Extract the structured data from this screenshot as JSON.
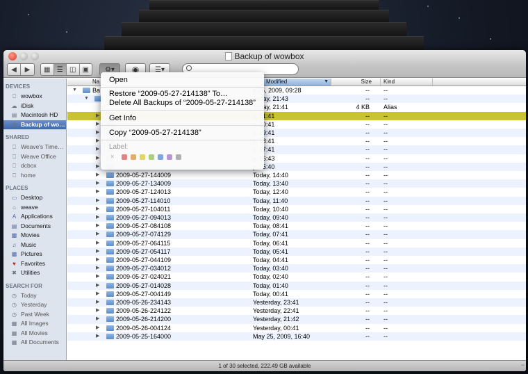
{
  "window": {
    "title": "Backup of wowbox",
    "status": "1 of 30 selected, 222.49 GB available"
  },
  "sidebar": {
    "sections": [
      {
        "title": "DEVICES",
        "items": [
          {
            "label": "wowbox",
            "icon": "computer-icon"
          },
          {
            "label": "iDisk",
            "icon": "idisk-icon"
          },
          {
            "label": "Macintosh HD",
            "icon": "hard-disk-icon"
          },
          {
            "label": "Backup of wo…",
            "icon": "time-machine-icon",
            "selected": true
          }
        ]
      },
      {
        "title": "SHARED",
        "items": [
          {
            "label": "Weave's Time…",
            "icon": "network-computer-icon"
          },
          {
            "label": "Weave Office",
            "icon": "network-computer-icon"
          },
          {
            "label": "dcbox",
            "icon": "network-computer-icon"
          },
          {
            "label": "home",
            "icon": "network-computer-icon"
          }
        ]
      },
      {
        "title": "PLACES",
        "items": [
          {
            "label": "Desktop",
            "icon": "desktop-icon"
          },
          {
            "label": "weave",
            "icon": "home-icon"
          },
          {
            "label": "Applications",
            "icon": "applications-icon"
          },
          {
            "label": "Documents",
            "icon": "documents-icon"
          },
          {
            "label": "Movies",
            "icon": "movies-icon"
          },
          {
            "label": "Music",
            "icon": "music-icon"
          },
          {
            "label": "Pictures",
            "icon": "pictures-icon"
          },
          {
            "label": "Favorites",
            "icon": "heart-icon"
          },
          {
            "label": "Utilities",
            "icon": "utilities-icon"
          }
        ]
      },
      {
        "title": "SEARCH FOR",
        "items": [
          {
            "label": "Today",
            "icon": "clock-icon"
          },
          {
            "label": "Yesterday",
            "icon": "clock-icon"
          },
          {
            "label": "Past Week",
            "icon": "clock-icon"
          },
          {
            "label": "All Images",
            "icon": "smart-folder-icon"
          },
          {
            "label": "All Movies",
            "icon": "smart-folder-icon"
          },
          {
            "label": "All Documents",
            "icon": "smart-folder-icon"
          }
        ]
      }
    ]
  },
  "columns": {
    "name": "Na",
    "date": "Modified",
    "size": "Size",
    "kind": "Kind"
  },
  "rows": [
    {
      "name": "Ba",
      "date": "y 25, 2009, 09:28",
      "size": "--",
      "kind": "--"
    },
    {
      "name": "",
      "date": "Today, 21:43",
      "size": "--",
      "kind": "--"
    },
    {
      "name": "",
      "date": "Today, 21:41",
      "size": "4 KB",
      "kind": "Alias"
    },
    {
      "name": "",
      "date": "y, 21:41",
      "size": "--",
      "kind": "--",
      "selected": true
    },
    {
      "name": "",
      "date": "y, 20:41",
      "size": "--",
      "kind": "--"
    },
    {
      "name": "",
      "date": "y, 19:41",
      "size": "--",
      "kind": "--"
    },
    {
      "name": "",
      "date": "y, 18:41",
      "size": "--",
      "kind": "--"
    },
    {
      "name": "",
      "date": "y, 17:41",
      "size": "--",
      "kind": "--"
    },
    {
      "name": "",
      "date": "y, 16:43",
      "size": "--",
      "kind": "--"
    },
    {
      "name": "",
      "date": "y, 15:40",
      "size": "--",
      "kind": "--"
    },
    {
      "name": "2009-05-27-144009",
      "date": "Today, 14:40",
      "size": "--",
      "kind": "--"
    },
    {
      "name": "2009-05-27-134009",
      "date": "Today, 13:40",
      "size": "--",
      "kind": "--"
    },
    {
      "name": "2009-05-27-124013",
      "date": "Today, 12:40",
      "size": "--",
      "kind": "--"
    },
    {
      "name": "2009-05-27-114010",
      "date": "Today, 11:40",
      "size": "--",
      "kind": "--"
    },
    {
      "name": "2009-05-27-104011",
      "date": "Today, 10:40",
      "size": "--",
      "kind": "--"
    },
    {
      "name": "2009-05-27-094013",
      "date": "Today, 09:40",
      "size": "--",
      "kind": "--"
    },
    {
      "name": "2009-05-27-084108",
      "date": "Today, 08:41",
      "size": "--",
      "kind": "--"
    },
    {
      "name": "2009-05-27-074129",
      "date": "Today, 07:41",
      "size": "--",
      "kind": "--"
    },
    {
      "name": "2009-05-27-064115",
      "date": "Today, 06:41",
      "size": "--",
      "kind": "--"
    },
    {
      "name": "2009-05-27-054117",
      "date": "Today, 05:41",
      "size": "--",
      "kind": "--"
    },
    {
      "name": "2009-05-27-044109",
      "date": "Today, 04:41",
      "size": "--",
      "kind": "--"
    },
    {
      "name": "2009-05-27-034012",
      "date": "Today, 03:40",
      "size": "--",
      "kind": "--"
    },
    {
      "name": "2009-05-27-024021",
      "date": "Today, 02:40",
      "size": "--",
      "kind": "--"
    },
    {
      "name": "2009-05-27-014028",
      "date": "Today, 01:40",
      "size": "--",
      "kind": "--"
    },
    {
      "name": "2009-05-27-004149",
      "date": "Today, 00:41",
      "size": "--",
      "kind": "--"
    },
    {
      "name": "2009-05-26-234143",
      "date": "Yesterday, 23:41",
      "size": "--",
      "kind": "--"
    },
    {
      "name": "2009-05-26-224122",
      "date": "Yesterday, 22:41",
      "size": "--",
      "kind": "--"
    },
    {
      "name": "2009-05-26-214200",
      "date": "Yesterday, 21:42",
      "size": "--",
      "kind": "--"
    },
    {
      "name": "2009-05-26-004124",
      "date": "Yesterday, 00:41",
      "size": "--",
      "kind": "--"
    },
    {
      "name": "2009-05-25-164000",
      "date": "May 25, 2009, 16:40",
      "size": "--",
      "kind": "--"
    }
  ],
  "context_menu": {
    "open": "Open",
    "restore": "Restore “2009-05-27-214138” To…",
    "delete_all": "Delete All Backups of “2009-05-27-214138”",
    "get_info": "Get Info",
    "copy": "Copy “2009-05-27-214138”",
    "label_title": "Label:",
    "label_colors": [
      "#e08585",
      "#e3ad6c",
      "#e2d36a",
      "#a9d07c",
      "#7fa6e3",
      "#b996d6",
      "#b0b0b0"
    ]
  },
  "colors": {
    "selection_row": "#c9c234",
    "sidebar_bg": "#dde4ee",
    "sidebar_selected": "#3f68ae"
  }
}
